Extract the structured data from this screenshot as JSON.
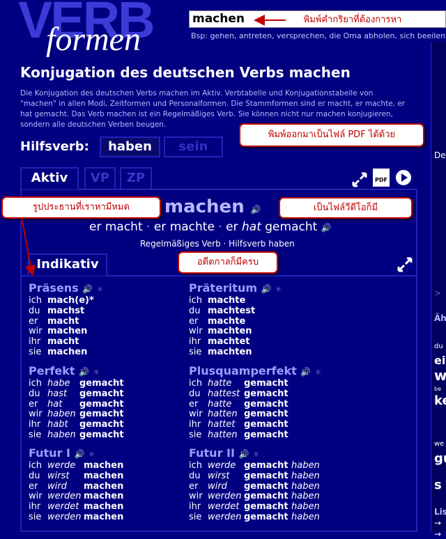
{
  "logo": {
    "verb": "VERB",
    "formen": "formen"
  },
  "search": {
    "value": "machen",
    "examples": "Bsp: gehen, antreten, versprechen, die Oma abholen, sich beeilen, bes"
  },
  "page": {
    "title": "Konjugation des deutschen Verbs machen",
    "intro": "Die Konjugation des deutschen Verbs machen im Aktiv. Verbtabelle und Konjugationstabelle von \"machen\" in allen Modi, Zeitformen und Personalformen. Die Stammformen sind er macht, er machte, er hat gemacht. Das Verb machen ist ein Regelmäßiges Verb. Sie können nicht nur machen konjugieren, sondern alle deutschen Verben beugen."
  },
  "hilfsverb": {
    "label": "Hilfsverb:",
    "options": [
      "haben",
      "sein"
    ]
  },
  "voice_tabs": [
    "Aktiv",
    "VP",
    "ZP"
  ],
  "controls": {
    "pdf": "PDF",
    "icons": [
      "expand-icon",
      "pdf-icon",
      "play-icon"
    ]
  },
  "verb": {
    "title": "machen",
    "form1": "er macht",
    "form2": "er machte",
    "form3_aux": "er",
    "form3_aux_italic": "hat",
    "form3_part": "gemacht",
    "separator": "·",
    "info": "Regelmäßiges Verb · Hilfsverb haben"
  },
  "mode_tab": "Indikativ",
  "tenses": [
    {
      "name": "Präsens",
      "rows": [
        [
          "ich",
          "",
          "mach(e)*",
          ""
        ],
        [
          "du",
          "",
          "machst",
          ""
        ],
        [
          "er",
          "",
          "macht",
          ""
        ],
        [
          "wir",
          "",
          "machen",
          ""
        ],
        [
          "ihr",
          "",
          "macht",
          ""
        ],
        [
          "sie",
          "",
          "machen",
          ""
        ]
      ]
    },
    {
      "name": "Präteritum",
      "rows": [
        [
          "ich",
          "",
          "machte",
          ""
        ],
        [
          "du",
          "",
          "machtest",
          ""
        ],
        [
          "er",
          "",
          "machte",
          ""
        ],
        [
          "wir",
          "",
          "machten",
          ""
        ],
        [
          "ihr",
          "",
          "machtet",
          ""
        ],
        [
          "sie",
          "",
          "machten",
          ""
        ]
      ]
    },
    {
      "name": "Perfekt",
      "rows": [
        [
          "ich",
          "habe",
          "gemacht",
          ""
        ],
        [
          "du",
          "hast",
          "gemacht",
          ""
        ],
        [
          "er",
          "hat",
          "gemacht",
          ""
        ],
        [
          "wir",
          "haben",
          "gemacht",
          ""
        ],
        [
          "ihr",
          "habt",
          "gemacht",
          ""
        ],
        [
          "sie",
          "haben",
          "gemacht",
          ""
        ]
      ]
    },
    {
      "name": "Plusquamperfekt",
      "rows": [
        [
          "ich",
          "hatte",
          "gemacht",
          ""
        ],
        [
          "du",
          "hattest",
          "gemacht",
          ""
        ],
        [
          "er",
          "hatte",
          "gemacht",
          ""
        ],
        [
          "wir",
          "hatten",
          "gemacht",
          ""
        ],
        [
          "ihr",
          "hattet",
          "gemacht",
          ""
        ],
        [
          "sie",
          "hatten",
          "gemacht",
          ""
        ]
      ]
    },
    {
      "name": "Futur I",
      "rows": [
        [
          "ich",
          "werde",
          "machen",
          ""
        ],
        [
          "du",
          "wirst",
          "machen",
          ""
        ],
        [
          "er",
          "wird",
          "machen",
          ""
        ],
        [
          "wir",
          "werden",
          "machen",
          ""
        ],
        [
          "ihr",
          "werdet",
          "machen",
          ""
        ],
        [
          "sie",
          "werden",
          "machen",
          ""
        ]
      ]
    },
    {
      "name": "Futur II",
      "rows": [
        [
          "ich",
          "werde",
          "gemacht",
          "haben"
        ],
        [
          "du",
          "wirst",
          "gemacht",
          "haben"
        ],
        [
          "er",
          "wird",
          "gemacht",
          "haben"
        ],
        [
          "wir",
          "werden",
          "gemacht",
          "haben"
        ],
        [
          "ihr",
          "werdet",
          "gemacht",
          "haben"
        ],
        [
          "sie",
          "werden",
          "gemacht",
          "haben"
        ]
      ]
    }
  ],
  "callouts": {
    "search": "พิมพ์คำกริยาที่ต้องการหา",
    "pdf": "พิมพ์ออกมาเป็นไฟล์ PDF ได้ด้วย",
    "subject": "รูปประธานที่เราหามีหมด",
    "video": "เป็นไฟล์วีดีโอก็มี",
    "past": "อดีตกาลก็มีครบ"
  },
  "right_edge": [
    "De",
    "Äh",
    "du",
    "ein",
    "w",
    "be",
    "ke",
    "we",
    "gu",
    "s",
    "Lis"
  ],
  "colors": {
    "background": "#000080",
    "border": "#2323b8",
    "tense_heading": "#9c9cff",
    "callout_border": "#c00000"
  }
}
